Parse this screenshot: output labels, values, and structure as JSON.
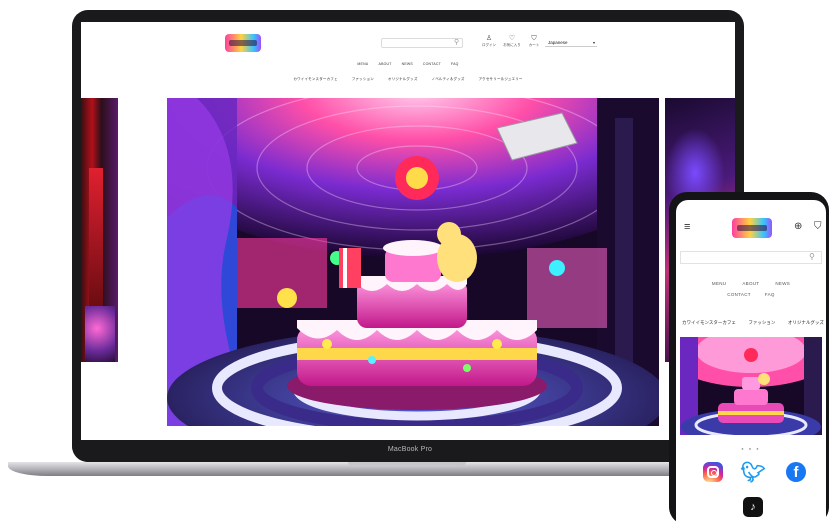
{
  "laptop": {
    "model_label": "MacBook Pro",
    "header": {
      "icons": [
        {
          "icon": "user-icon",
          "label": "ログイン"
        },
        {
          "icon": "heart-icon",
          "label": "お気に入り"
        },
        {
          "icon": "cart-icon",
          "label": "カート"
        }
      ],
      "language": "Japanese"
    },
    "nav": [
      "MENU",
      "ABOUT",
      "NEWS",
      "CONTACT",
      "FAQ"
    ],
    "categories": [
      "カワイイモンスターカフェ",
      "ファッション",
      "オリジナルグッズ",
      "ノベルティ＆グッズ",
      "アクセサリー＆ジュエリー"
    ]
  },
  "phone": {
    "nav_row1": [
      "MENU",
      "ABOUT",
      "NEWS"
    ],
    "nav_row2": [
      "CONTACT",
      "FAQ"
    ],
    "categories": [
      "カワイイモンスターカフェ",
      "ファッション",
      "オリジナルグッズ"
    ],
    "slider_dots": "● ● ●",
    "social": [
      "instagram-icon",
      "twitter-icon",
      "facebook-icon",
      "tiktok-icon"
    ]
  },
  "colors": {
    "bezel": "#1a1a1c",
    "instagram": "#d6249f",
    "twitter": "#1d9bf0",
    "facebook": "#1877f2"
  }
}
